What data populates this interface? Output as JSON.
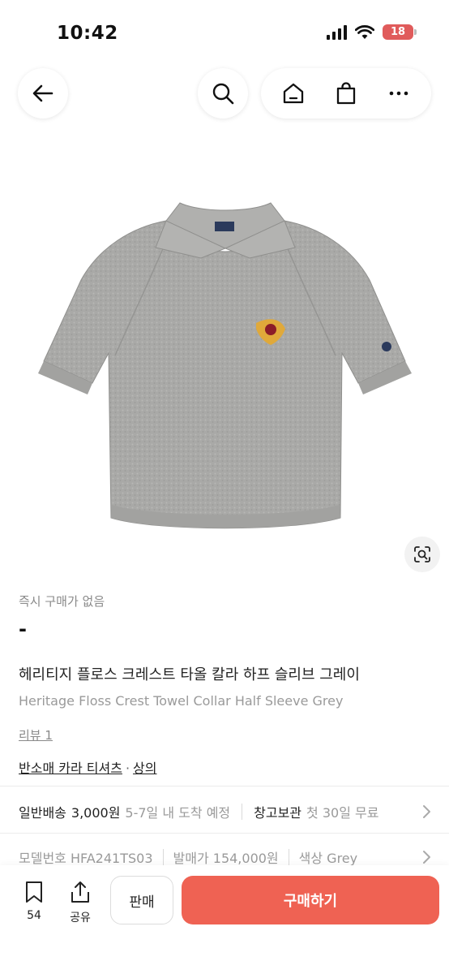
{
  "status_bar": {
    "time": "10:42",
    "battery": "18",
    "battery_color": "#e05b5b"
  },
  "nav": {
    "back_icon": "arrow-left-icon",
    "search_icon": "search-icon",
    "home_icon": "home-icon",
    "shop_icon": "shopping-bag-icon",
    "more_icon": "more-horizontal-icon"
  },
  "product": {
    "image_icon": "grey-collar-polo-tshirt",
    "lens_icon": "image-search-icon",
    "instant_purchase_label": "즉시 구매가 없음",
    "price": "-",
    "title_ko": "헤리티지 플로스 크레스트 타올 칼라 하프 슬리브 그레이",
    "title_en": "Heritage Floss Crest Towel Collar Half Sleeve Grey",
    "review_label": "리뷰 1",
    "category_primary": "반소매 카라 티셔츠",
    "category_separator": "·",
    "category_secondary": "상의"
  },
  "shipping": {
    "label": "일반배송",
    "price": "3,000원",
    "days": "5-7일 내 도착 예정",
    "storage_label": "창고보관",
    "storage_sub": "첫 30일 무료"
  },
  "details": {
    "model": "모델번호 HFA241TS03",
    "release_price": "발매가 154,000원",
    "color": "색상 Grey"
  },
  "bottom_bar": {
    "bookmark_count": "54",
    "share_label": "공유",
    "sell_label": "판매",
    "buy_label": "구매하기",
    "buy_color": "#ef6253"
  }
}
